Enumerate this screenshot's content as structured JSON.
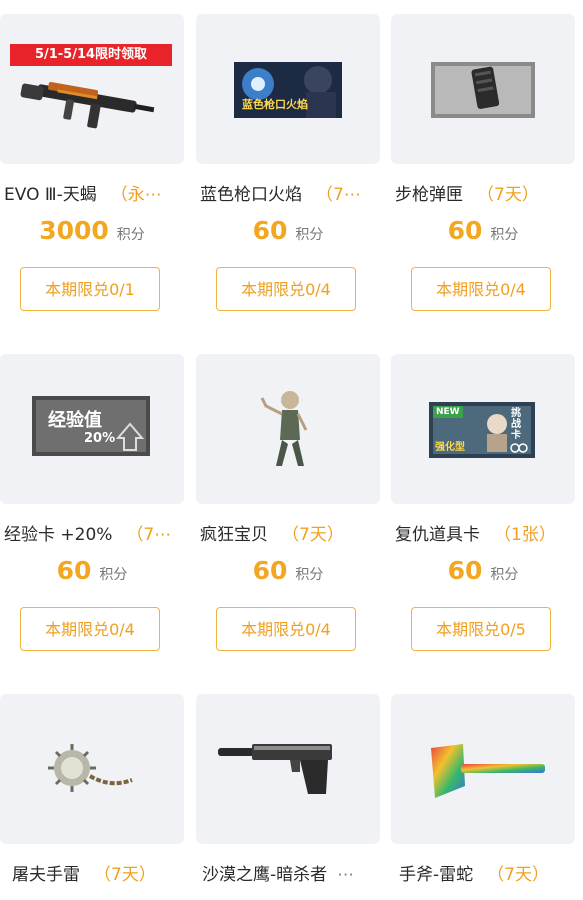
{
  "items": [
    {
      "name": "EVO Ⅲ-天蝎",
      "duration": "（永⋯",
      "price": "3000",
      "unit": "积分",
      "limit": "本期限兑0/1",
      "badge": "5/1-5/14限时领取"
    },
    {
      "name": "蓝色枪口火焰",
      "duration": "（7⋯",
      "price": "60",
      "unit": "积分",
      "limit": "本期限兑0/4",
      "thumb_caption": "蓝色枪口火焰"
    },
    {
      "name": "步枪弹匣",
      "duration": "（7天）",
      "price": "60",
      "unit": "积分",
      "limit": "本期限兑0/4"
    },
    {
      "name": "经验卡 +20%",
      "duration": "（7⋯",
      "price": "60",
      "unit": "积分",
      "limit": "本期限兑0/4",
      "thumb_caption": "经验值",
      "thumb_caption2": "20%"
    },
    {
      "name": "疯狂宝贝",
      "duration": "（7天）",
      "price": "60",
      "unit": "积分",
      "limit": "本期限兑0/4"
    },
    {
      "name": "复仇道具卡",
      "duration": "（1张）",
      "price": "60",
      "unit": "积分",
      "limit": "本期限兑0/5",
      "thumb_caption": "挑战卡",
      "thumb_badge": "NEW",
      "thumb_caption2": "强化型"
    },
    {
      "name": "屠夫手雷",
      "duration": "（7天）",
      "price": "",
      "unit": "",
      "limit": ""
    },
    {
      "name": "沙漠之鹰-暗杀者",
      "duration": "⋯",
      "price": "",
      "unit": "",
      "limit": ""
    },
    {
      "name": "手斧-雷蛇",
      "duration": "（7天）",
      "price": "",
      "unit": "",
      "limit": ""
    }
  ],
  "colors": {
    "accent": "#f3a61f",
    "card_bg": "#f0f2f5",
    "promo_red": "#e8242a"
  }
}
